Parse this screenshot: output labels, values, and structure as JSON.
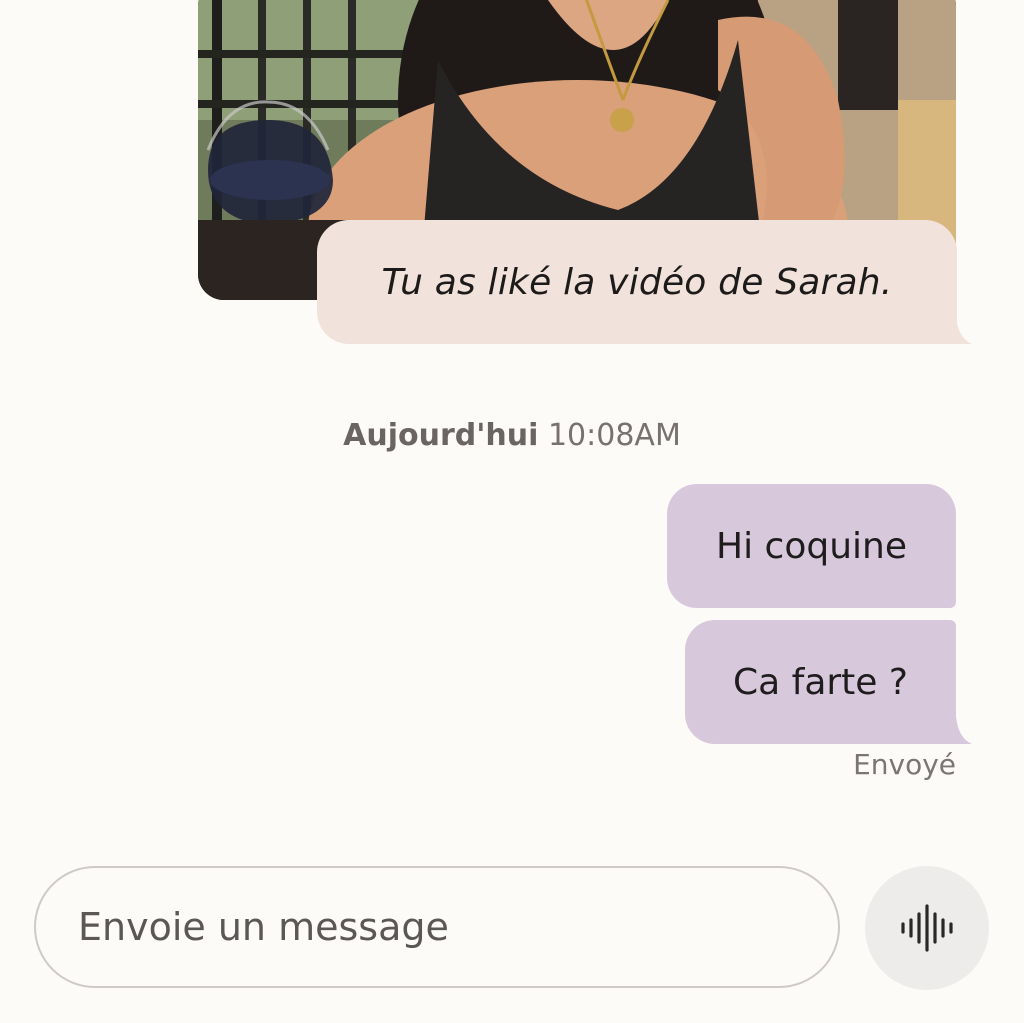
{
  "conversation": {
    "shared_media": {
      "icon": "photo-thumbnail",
      "reaction_text": "Tu as liké la vidéo de Sarah."
    },
    "divider": {
      "day": "Aujourd'hui",
      "time": "10:08AM"
    },
    "messages": [
      {
        "text": "Hi coquine"
      },
      {
        "text": "Ca farte ?"
      }
    ],
    "status": "Envoyé"
  },
  "composer": {
    "placeholder": "Envoie un message",
    "voice_icon": "voice-waveform-icon"
  },
  "colors": {
    "background": "#fdfbf8",
    "reaction_bubble": "#f2e2dc",
    "outgoing_bubble": "#d8c8dc",
    "voice_button": "#eeeceb"
  }
}
